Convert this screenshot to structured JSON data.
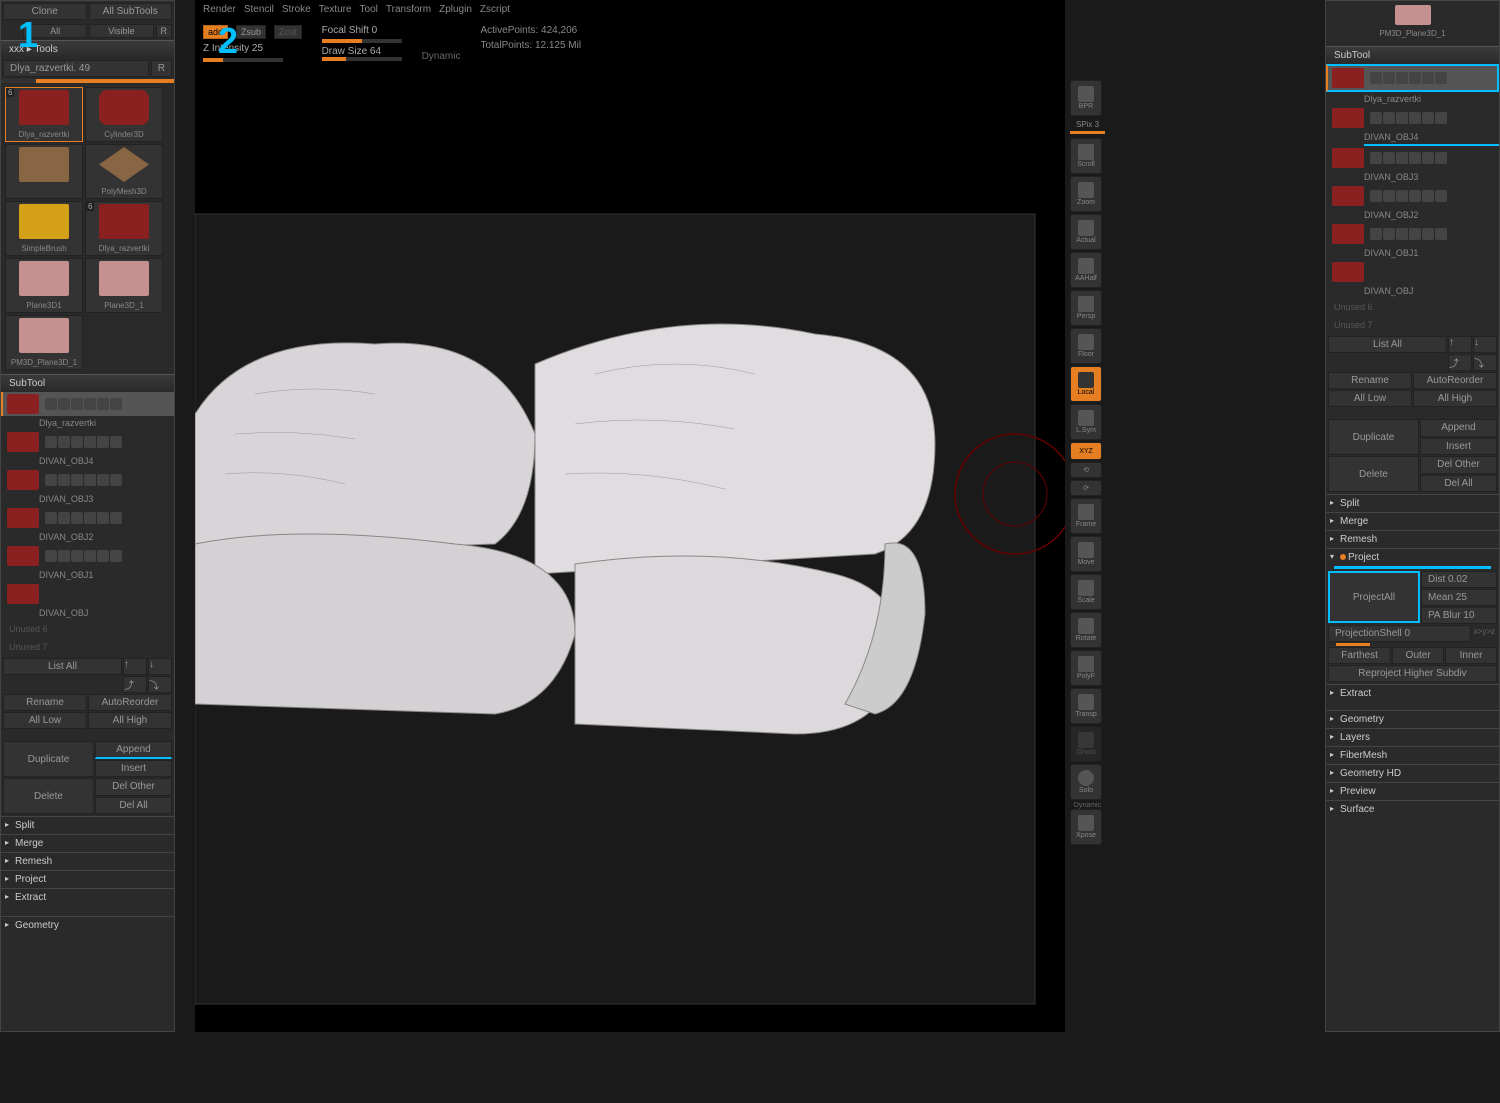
{
  "left": {
    "clone": "Clone",
    "all_subtools": "All SubTools",
    "all": "All",
    "visible": "Visible",
    "r": "R",
    "tools_header": "xxx ▸ Tools",
    "current_tool": "Dlya_razvertki. 49",
    "tools": [
      {
        "name": "Dlya_razvertki",
        "badge": "6",
        "color": "#8b2020"
      },
      {
        "name": "Cylinder3D",
        "color": "#8b2020"
      },
      {
        "name": "",
        "color": "#666"
      },
      {
        "name": "PolyMesh3D",
        "color": "#666"
      },
      {
        "name": "SimpleBrush",
        "color": "#d4a017"
      },
      {
        "name": "Dlya_razvertki",
        "badge": "6",
        "color": "#8b2020"
      },
      {
        "name": "Plane3D1",
        "color": "#c49090"
      },
      {
        "name": "Plane3D_1",
        "color": "#c49090"
      },
      {
        "name": "PM3D_Plane3D_1",
        "color": "#c49090"
      }
    ],
    "subtool_header": "SubTool",
    "subtools": [
      {
        "name": "Dlya_razvertki",
        "active": true
      },
      {
        "name": "DIVAN_OBJ4"
      },
      {
        "name": "DIVAN_OBJ3"
      },
      {
        "name": "DIVAN_OBJ2"
      },
      {
        "name": "DIVAN_OBJ1"
      },
      {
        "name": "DIVAN_OBJ"
      }
    ],
    "unused_6": "Unused 6",
    "unused_7": "Unused 7",
    "list_all": "List All",
    "rename": "Rename",
    "auto_reorder": "AutoReorder",
    "all_low": "All Low",
    "all_high": "All High",
    "duplicate": "Duplicate",
    "append": "Append",
    "insert": "Insert",
    "delete": "Delete",
    "del_other": "Del Other",
    "del_all": "Del All",
    "split": "Split",
    "merge": "Merge",
    "remesh": "Remesh",
    "project": "Project",
    "extract": "Extract",
    "geometry": "Geometry"
  },
  "top": {
    "menu": [
      "Render",
      "Stencil",
      "Stroke",
      "Texture",
      "Tool",
      "Transform",
      "Zplugin",
      "Zscript"
    ],
    "zadd": "add",
    "zsub": "Zsub",
    "zcut": "Zcut",
    "z_intensity": "Z Intensity 25",
    "focal_shift": "Focal Shift 0",
    "draw_size": "Draw Size 64",
    "dynamic": "Dynamic",
    "active_points": "ActivePoints: 424,206",
    "total_points": "TotalPoints: 12.125 Mil"
  },
  "vp_toolbar": {
    "bpr": "BPR",
    "spix": "SPix 3",
    "scroll": "Scroll",
    "zoom": "Zoom",
    "actual": "Actual",
    "aahalf": "AAHalf",
    "persp": "Persp",
    "floor": "Floor",
    "local": "Local",
    "lsym": "L.Sym",
    "xyz": "XYZ",
    "frame": "Frame",
    "move": "Move",
    "scale": "Scale",
    "rotate": "Rotate",
    "polyf": "PolyF",
    "transp": "Transp",
    "ghost": "Ghost",
    "dynamic": "Dynamic",
    "solo": "Solo",
    "xpose": "Xpose"
  },
  "right": {
    "top_tool": "PM3D_Plane3D_1",
    "subtool_header": "SubTool",
    "subtools": [
      {
        "name": "Dlya_razvertki",
        "active": true
      },
      {
        "name": "DIVAN_OBJ4"
      },
      {
        "name": "DIVAN_OBJ3"
      },
      {
        "name": "DIVAN_OBJ2"
      },
      {
        "name": "DIVAN_OBJ1"
      },
      {
        "name": "DIVAN_OBJ"
      }
    ],
    "unused_6": "Unused 6",
    "unused_7": "Unused 7",
    "list_all": "List All",
    "rename": "Rename",
    "auto_reorder": "AutoReorder",
    "all_low": "All Low",
    "all_high": "All High",
    "duplicate": "Duplicate",
    "append": "Append",
    "insert": "Insert",
    "delete": "Delete",
    "del_other": "Del Other",
    "del_all": "Del All",
    "split": "Split",
    "merge": "Merge",
    "remesh": "Remesh",
    "project": "Project",
    "project_all": "ProjectAll",
    "dist": "Dist 0.02",
    "mean": "Mean 25",
    "pa_blur": "PA Blur 10",
    "projection_shell": "ProjectionShell 0",
    "xyz_link": "x>y>z",
    "farthest": "Farthest",
    "outer": "Outer",
    "inner": "Inner",
    "reproject": "Reproject Higher Subdiv",
    "extract": "Extract",
    "sections": [
      "Geometry",
      "Layers",
      "FiberMesh",
      "Geometry HD",
      "Preview",
      "Surface"
    ]
  },
  "markers": {
    "m1": "1",
    "m2": "2"
  }
}
